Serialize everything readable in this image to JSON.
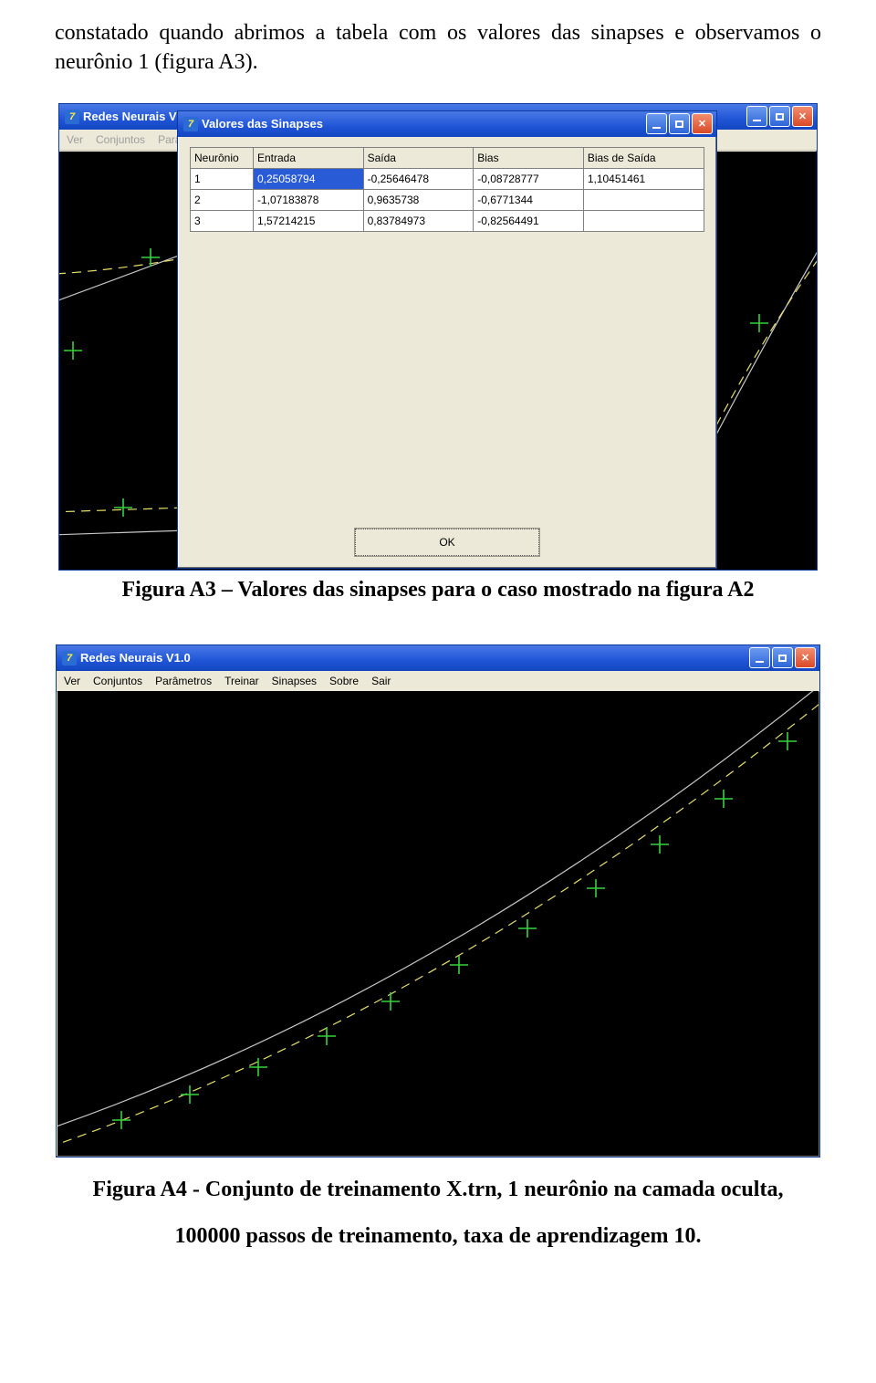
{
  "para": "constatado quando abrimos a tabela com os valores das sinapses e observamos o neurônio 1 (figura A3).",
  "cap1": "Figura A3 – Valores das sinapses para o caso mostrado na figura A2",
  "cap2a": "Figura A4 - Conjunto de treinamento X.trn, 1 neurônio na camada oculta,",
  "cap2b": "100000 passos de treinamento, taxa de aprendizagem 10.",
  "app_title": "Redes Neurais V1.0",
  "dlg_title": "Valores das Sinapses",
  "menu_bg": [
    "Ver",
    "Conjuntos",
    "Parâmetros"
  ],
  "menu_full": [
    "Ver",
    "Conjuntos",
    "Parâmetros",
    "Treinar",
    "Sinapses",
    "Sobre",
    "Sair"
  ],
  "th": {
    "n": "Neurônio",
    "e": "Entrada",
    "s": "Saída",
    "b": "Bias",
    "bs": "Bias de Saída"
  },
  "rows": [
    {
      "n": "1",
      "e": "0,25058794",
      "s": "-0,25646478",
      "b": "-0,08728777",
      "bs": "1,10451461"
    },
    {
      "n": "2",
      "e": "-1,07183878",
      "s": "0,9635738",
      "b": "-0,6771344",
      "bs": ""
    },
    {
      "n": "3",
      "e": "1,57214215",
      "s": "0,83784973",
      "b": "-0,82564491",
      "bs": ""
    }
  ],
  "ok": "OK"
}
